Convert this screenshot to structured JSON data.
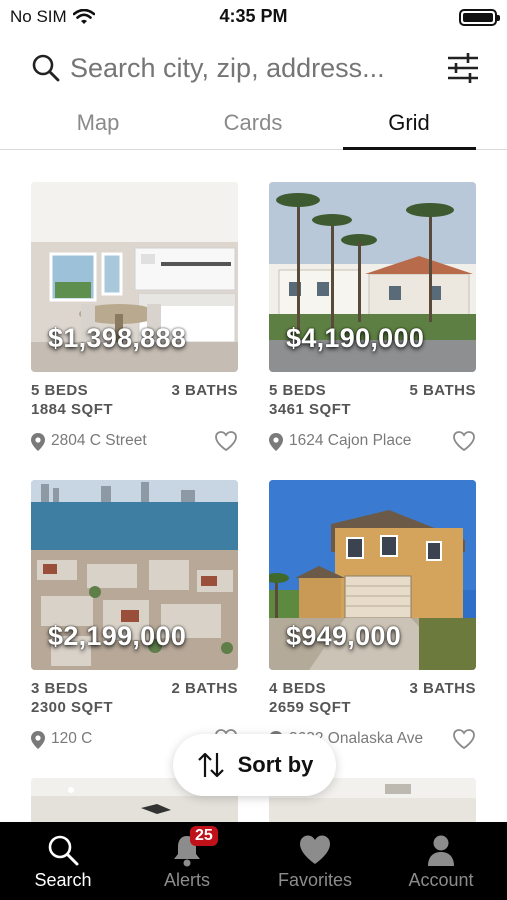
{
  "status_bar": {
    "carrier": "No SIM",
    "time": "4:35 PM"
  },
  "search": {
    "placeholder": "Search city, zip, address..."
  },
  "tabs": [
    {
      "label": "Map",
      "active": false
    },
    {
      "label": "Cards",
      "active": false
    },
    {
      "label": "Grid",
      "active": true
    }
  ],
  "listings": [
    {
      "price": "$1,398,888",
      "beds": "5 BEDS",
      "baths": "3 BATHS",
      "sqft": "1884 SQFT",
      "address": "2804 C Street"
    },
    {
      "price": "$4,190,000",
      "beds": "5 BEDS",
      "baths": "5 BATHS",
      "sqft": "3461 SQFT",
      "address": "1624 Cajon Place"
    },
    {
      "price": "$2,199,000",
      "beds": "3 BEDS",
      "baths": "2 BATHS",
      "sqft": "2300 SQFT",
      "address": "120 C"
    },
    {
      "price": "$949,000",
      "beds": "4 BEDS",
      "baths": "3 BATHS",
      "sqft": "2659 SQFT",
      "address": "3632 Onalaska Ave"
    }
  ],
  "sort": {
    "label": "Sort by"
  },
  "bottom_nav": [
    {
      "label": "Search",
      "icon": "search-icon",
      "active": true
    },
    {
      "label": "Alerts",
      "icon": "bell-icon",
      "badge": "25",
      "active": false
    },
    {
      "label": "Favorites",
      "icon": "heart-icon",
      "active": false
    },
    {
      "label": "Account",
      "icon": "person-icon",
      "active": false
    }
  ],
  "colors": {
    "badge": "#c0101a",
    "nav_bg": "#000000",
    "active_text": "#ffffff",
    "inactive_text": "#8c8c8c"
  }
}
